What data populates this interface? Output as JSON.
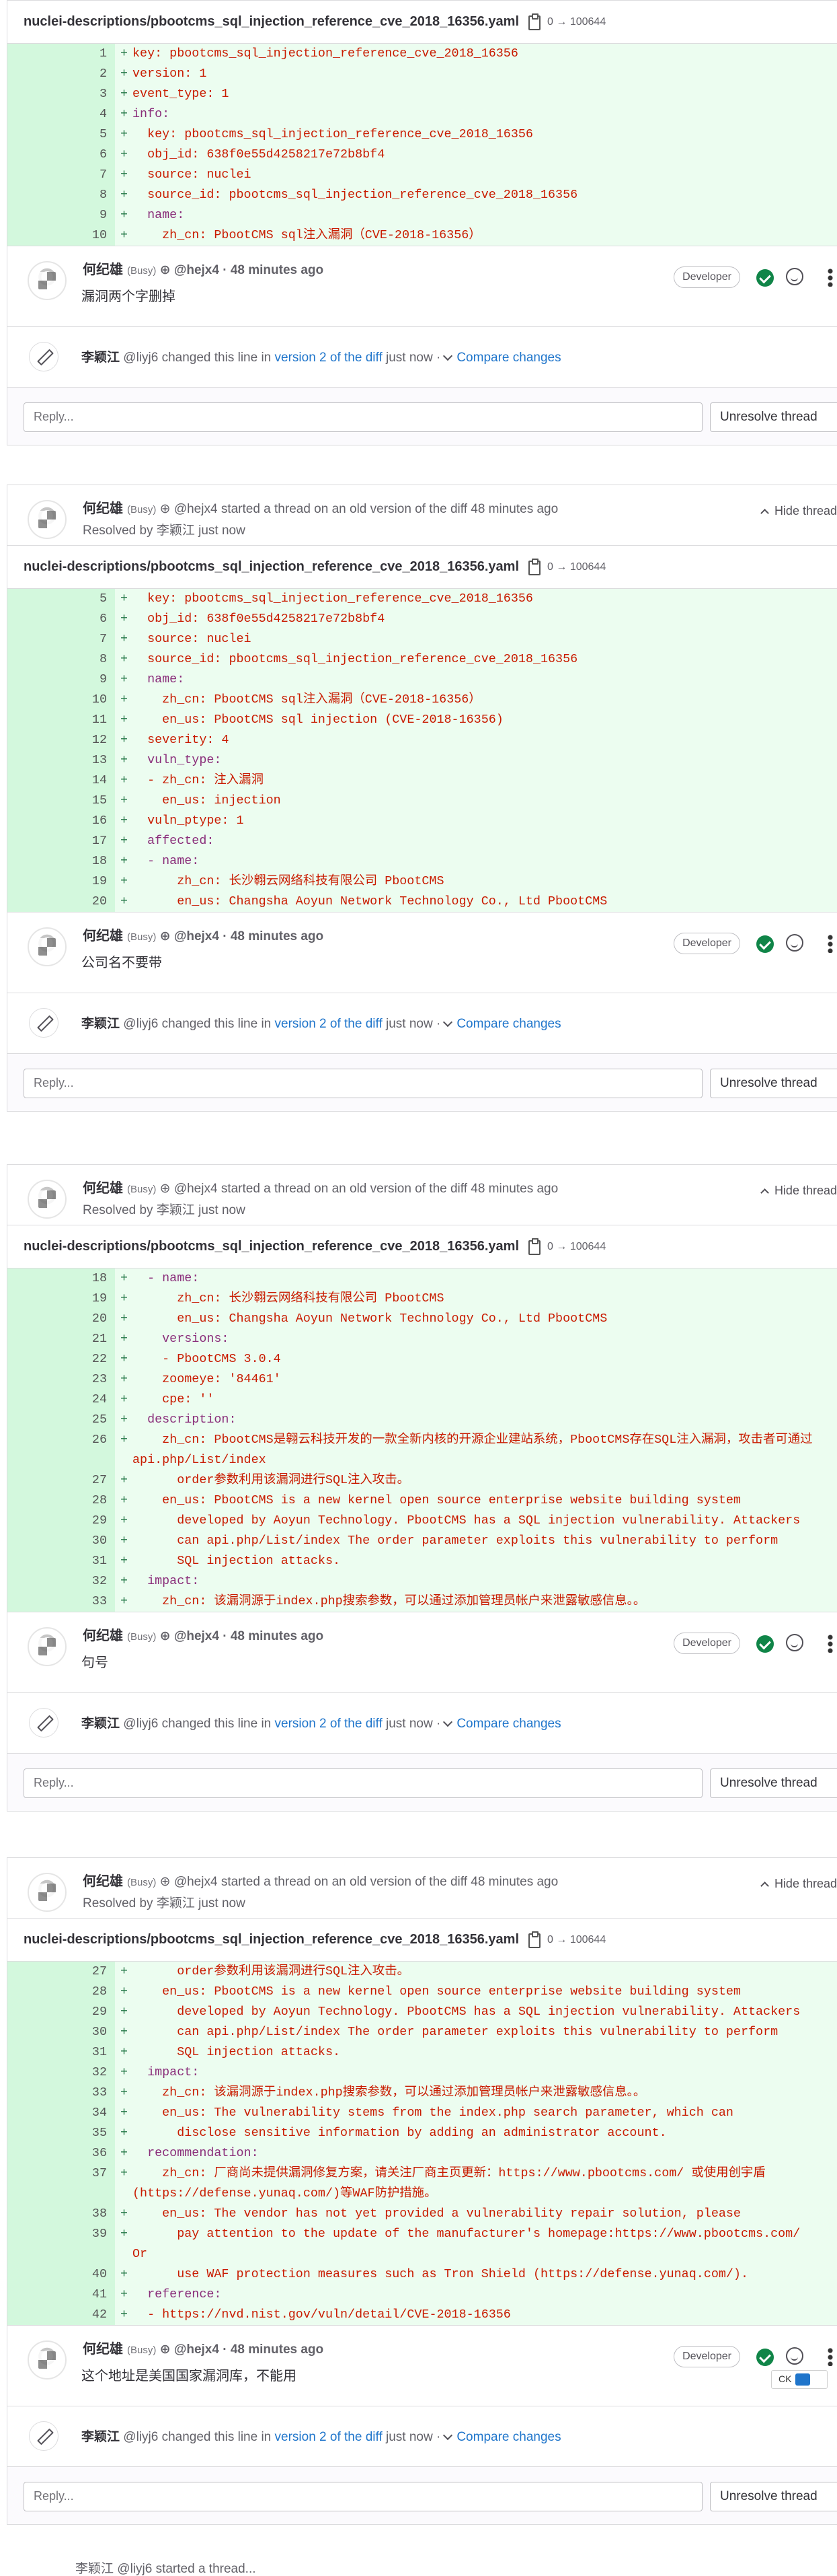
{
  "file": {
    "name": "nuclei-descriptions/pbootcms_sql_injection_reference_cve_2018_16356.yaml",
    "mode": "0 → 100644"
  },
  "labels": {
    "busy": "(Busy)",
    "developer": "Developer",
    "reply_placeholder": "Reply...",
    "unresolve": "Unresolve thread",
    "hide": "Hide thread",
    "compare": "Compare changes",
    "version_link": "version 2 of the diff",
    "just_now": "just now ·",
    "changed_this_line": "changed this line in",
    "resolved_by": "Resolved by",
    "resolver": "李颖江",
    "just_now2": "just now"
  },
  "people": {
    "author": "何纪雄",
    "author_handle": "@hejx4",
    "editor": "李颖江",
    "editor_handle": "@liyj6"
  },
  "threads": [
    {
      "started": "",
      "time": "· 48 minutes ago",
      "comment": "漏洞两个字删掉",
      "lines": [
        [
          "1",
          "key: pbootcms_sql_injection_reference_cve_2018_16356"
        ],
        [
          "2",
          "version: 1"
        ],
        [
          "3",
          "event_type: 1"
        ],
        [
          "4",
          "info:"
        ],
        [
          "5",
          "  key: pbootcms_sql_injection_reference_cve_2018_16356"
        ],
        [
          "6",
          "  obj_id: 638f0e55d4258217e72b8bf4"
        ],
        [
          "7",
          "  source: nuclei"
        ],
        [
          "8",
          "  source_id: pbootcms_sql_injection_reference_cve_2018_16356"
        ],
        [
          "9",
          "  name:"
        ],
        [
          "10",
          "    zh_cn: PbootCMS sql注入漏洞（CVE-2018-16356）"
        ]
      ]
    },
    {
      "started": "started a thread on an old version of the diff 48 minutes ago",
      "time": "· 48 minutes ago",
      "comment": "公司名不要带",
      "lines": [
        [
          "5",
          "  key: pbootcms_sql_injection_reference_cve_2018_16356"
        ],
        [
          "6",
          "  obj_id: 638f0e55d4258217e72b8bf4"
        ],
        [
          "7",
          "  source: nuclei"
        ],
        [
          "8",
          "  source_id: pbootcms_sql_injection_reference_cve_2018_16356"
        ],
        [
          "9",
          "  name:"
        ],
        [
          "10",
          "    zh_cn: PbootCMS sql注入漏洞（CVE-2018-16356）"
        ],
        [
          "11",
          "    en_us: PbootCMS sql injection (CVE-2018-16356)"
        ],
        [
          "12",
          "  severity: 4"
        ],
        [
          "13",
          "  vuln_type:"
        ],
        [
          "14",
          "  - zh_cn: 注入漏洞"
        ],
        [
          "15",
          "    en_us: injection"
        ],
        [
          "16",
          "  vuln_ptype: 1"
        ],
        [
          "17",
          "  affected:"
        ],
        [
          "18",
          "  - name:"
        ],
        [
          "19",
          "      zh_cn: 长沙翱云网络科技有限公司 PbootCMS"
        ],
        [
          "20",
          "      en_us: Changsha Aoyun Network Technology Co., Ltd PbootCMS"
        ]
      ]
    },
    {
      "started": "started a thread on an old version of the diff 48 minutes ago",
      "time": "· 48 minutes ago",
      "comment": "句号",
      "lines": [
        [
          "18",
          "  - name:"
        ],
        [
          "19",
          "      zh_cn: 长沙翱云网络科技有限公司 PbootCMS"
        ],
        [
          "20",
          "      en_us: Changsha Aoyun Network Technology Co., Ltd PbootCMS"
        ],
        [
          "21",
          "    versions:"
        ],
        [
          "22",
          "    - PbootCMS 3.0.4"
        ],
        [
          "23",
          "    zoomeye: '84461'"
        ],
        [
          "24",
          "    cpe: ''"
        ],
        [
          "25",
          "  description:"
        ],
        [
          "26",
          "    zh_cn: PbootCMS是翱云科技开发的一款全新内核的开源企业建站系统，PbootCMS存在SQL注入漏洞，攻击者可通过\napi.php/List/index"
        ],
        [
          "27",
          "      order参数利用该漏洞进行SQL注入攻击。"
        ],
        [
          "28",
          "    en_us: PbootCMS is a new kernel open source enterprise website building system"
        ],
        [
          "29",
          "      developed by Aoyun Technology. PbootCMS has a SQL injection vulnerability. Attackers"
        ],
        [
          "30",
          "      can api.php/List/index The order parameter exploits this vulnerability to perform"
        ],
        [
          "31",
          "      SQL injection attacks."
        ],
        [
          "32",
          "  impact:"
        ],
        [
          "33",
          "    zh_cn: 该漏洞源于index.php搜索参数，可以通过添加管理员帐户来泄露敏感信息。。"
        ]
      ]
    },
    {
      "started": "started a thread on an old version of the diff 48 minutes ago",
      "time": "· 48 minutes ago",
      "comment": "这个地址是美国国家漏洞库，不能用",
      "lines": [
        [
          "27",
          "      order参数利用该漏洞进行SQL注入攻击。"
        ],
        [
          "28",
          "    en_us: PbootCMS is a new kernel open source enterprise website building system"
        ],
        [
          "29",
          "      developed by Aoyun Technology. PbootCMS has a SQL injection vulnerability. Attackers"
        ],
        [
          "30",
          "      can api.php/List/index The order parameter exploits this vulnerability to perform"
        ],
        [
          "31",
          "      SQL injection attacks."
        ],
        [
          "32",
          "  impact:"
        ],
        [
          "33",
          "    zh_cn: 该漏洞源于index.php搜索参数，可以通过添加管理员帐户来泄露敏感信息。。"
        ],
        [
          "34",
          "    en_us: The vulnerability stems from the index.php search parameter, which can"
        ],
        [
          "35",
          "      disclose sensitive information by adding an administrator account."
        ],
        [
          "36",
          "  recommendation:"
        ],
        [
          "37",
          "    zh_cn: 厂商尚未提供漏洞修复方案，请关注厂商主页更新：https://www.pbootcms.com/ 或使用创宇盾\n(https://defense.yunaq.com/)等WAF防护措施。"
        ],
        [
          "38",
          "    en_us: The vendor has not yet provided a vulnerability repair solution, please"
        ],
        [
          "39",
          "      pay attention to the update of the manufacturer's homepage:https://www.pbootcms.com/\nOr"
        ],
        [
          "40",
          "      use WAF protection measures such as Tron Shield (https://defense.yunaq.com/)."
        ],
        [
          "41",
          "  reference:"
        ],
        [
          "42",
          "  - https://nvd.nist.gov/vuln/detail/CVE-2018-16356"
        ]
      ]
    }
  ],
  "ime": {
    "label": "CK"
  },
  "footer": {
    "text": "李颖江 @liyj6 started a thread..."
  }
}
